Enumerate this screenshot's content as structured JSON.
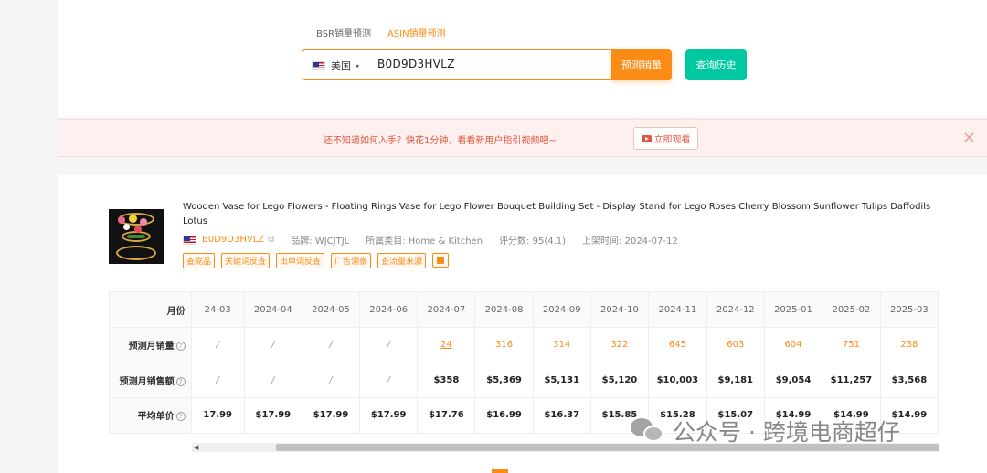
{
  "tabs": [
    "BSR销量预测",
    "ASIN销量预测"
  ],
  "search": {
    "country": "美国",
    "asin_value": "B0D9D3HVLZ",
    "predict_button": "预测销量",
    "history_button": "查询历史"
  },
  "banner": {
    "text": "还不知道如何入手？快花1分钟，看看新用户指引视频吧~",
    "watch_button": "立即观看"
  },
  "product": {
    "title": "Wooden Vase for Lego Flowers - Floating Rings Vase for Lego Flower Bouquet Building Set - Display Stand for Lego Roses Cherry Blossom Sunflower Tulips Daffodils Lotus",
    "asin": "B0D9D3HVLZ",
    "brand": "品牌: WJCJTJL",
    "category": "所属类目: Home & Kitchen",
    "rating": "评分数: 95(4.1)",
    "listed": "上架时间: 2024-07-12",
    "tags": [
      "查竞品",
      "关键词反查",
      "出单词反查",
      "广告洞察",
      "查流量来源"
    ]
  },
  "table": {
    "row_labels": {
      "month": "月份",
      "sales": "预测月销量",
      "revenue": "预测月销售额",
      "price": "平均单价"
    },
    "months": [
      "24-03",
      "2024-04",
      "2024-05",
      "2024-06",
      "2024-07",
      "2024-08",
      "2024-09",
      "2024-10",
      "2024-11",
      "2024-12",
      "2025-01",
      "2025-02",
      "2025-03"
    ],
    "sales": [
      "/",
      "/",
      "/",
      "/",
      "24",
      "316",
      "314",
      "322",
      "645",
      "603",
      "604",
      "751",
      "238"
    ],
    "revenue": [
      "/",
      "/",
      "/",
      "/",
      "$358",
      "$5,369",
      "$5,131",
      "$5,120",
      "$10,003",
      "$9,181",
      "$9,054",
      "$11,257",
      "$3,568"
    ],
    "price": [
      "17.99",
      "$17.99",
      "$17.99",
      "$17.99",
      "$17.76",
      "$16.99",
      "$16.37",
      "$15.85",
      "$15.28",
      "$15.07",
      "$14.99",
      "$14.99",
      "$14.99"
    ]
  },
  "watermark": "公众号 · 跨境电商超仔"
}
